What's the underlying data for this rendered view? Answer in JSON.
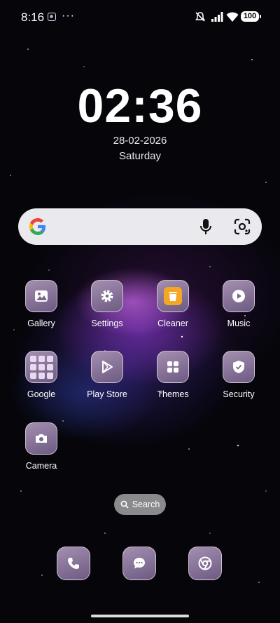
{
  "status_bar": {
    "time": "8:16",
    "overflow": "···",
    "battery": "100"
  },
  "lock": {
    "time": "02:36",
    "date": "28-02-2026",
    "day": "Saturday"
  },
  "search_widget": {
    "logo": "google-logo",
    "mic": "mic-icon",
    "lens": "lens-icon"
  },
  "apps": [
    {
      "label": "Gallery",
      "icon": "gallery-icon"
    },
    {
      "label": "Settings",
      "icon": "gear-icon"
    },
    {
      "label": "Cleaner",
      "icon": "trash-icon"
    },
    {
      "label": "Music",
      "icon": "play-icon"
    },
    {
      "label": "Google",
      "icon": "folder-icon"
    },
    {
      "label": "Play Store",
      "icon": "play-store-icon"
    },
    {
      "label": "Themes",
      "icon": "grid-icon"
    },
    {
      "label": "Security",
      "icon": "shield-icon"
    },
    {
      "label": "Camera",
      "icon": "camera-icon"
    }
  ],
  "search_pill": {
    "label": "Search"
  },
  "dock": [
    {
      "icon": "phone-icon"
    },
    {
      "icon": "messages-icon"
    },
    {
      "icon": "chrome-icon"
    }
  ],
  "colors": {
    "tile": "#8f7aa3",
    "cleaner": "#f5a623",
    "search_bg": "#e9e9ee"
  }
}
